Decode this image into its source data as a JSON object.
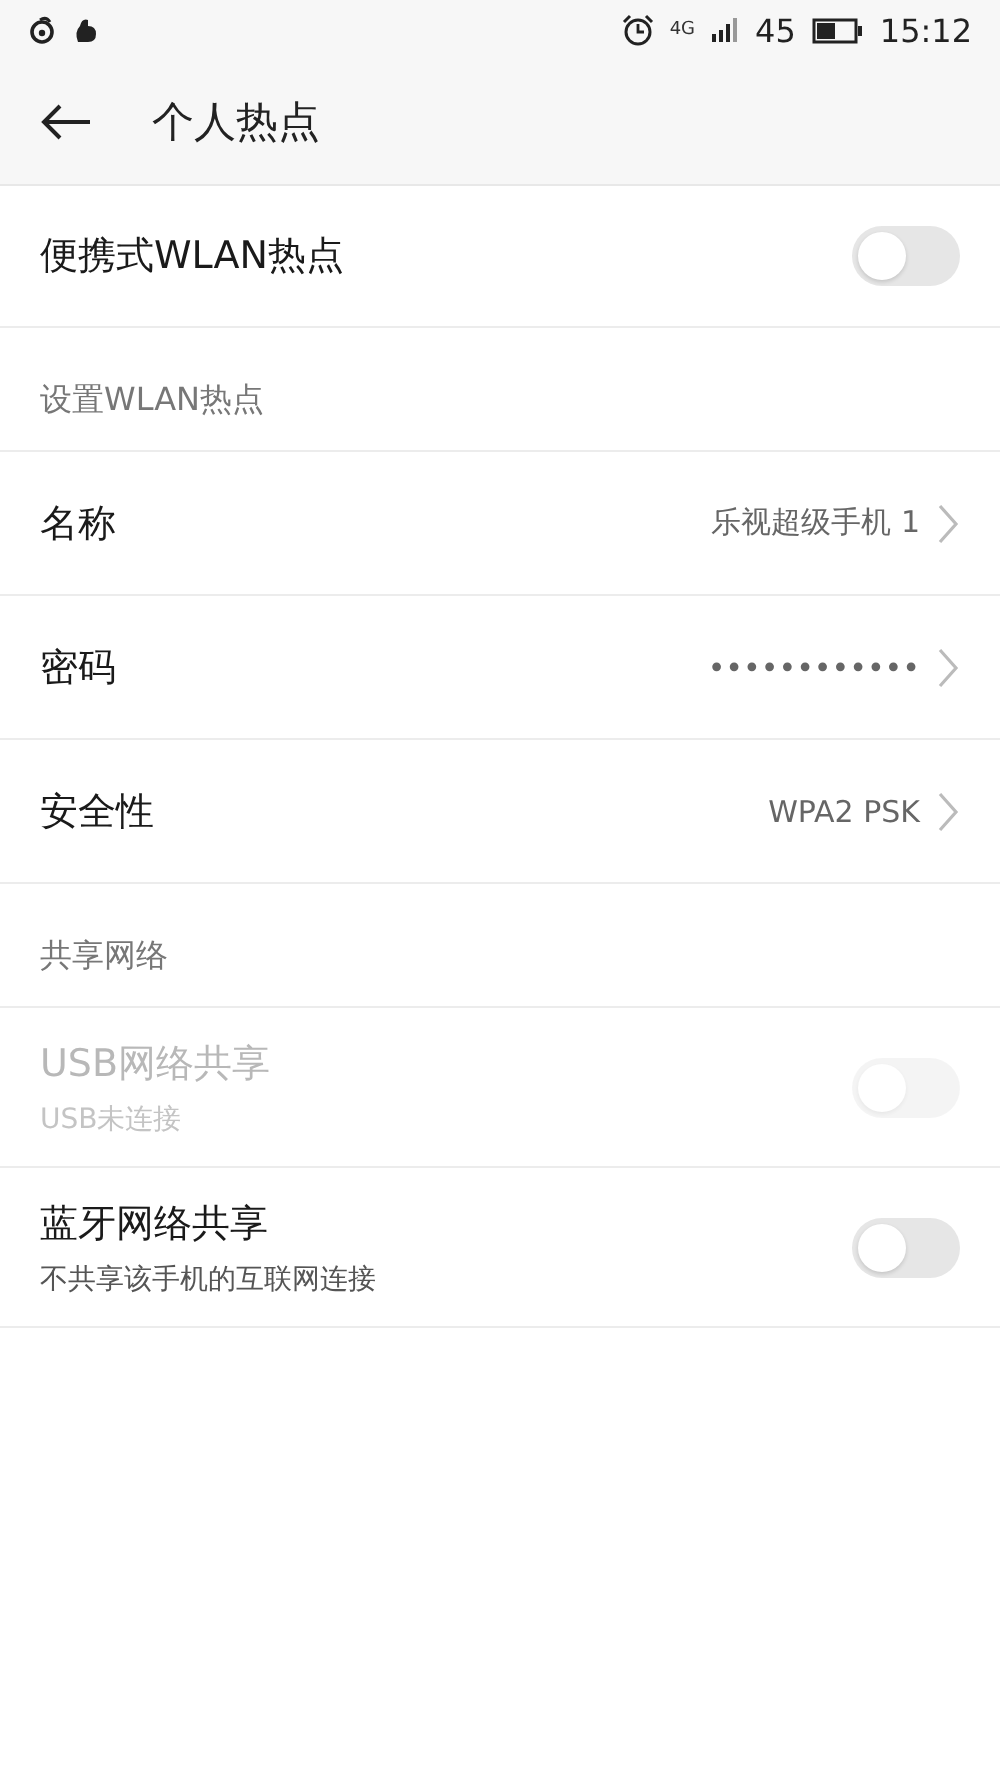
{
  "status_bar": {
    "network": "4G",
    "battery": "45",
    "time": "15:12"
  },
  "header": {
    "title": "个人热点"
  },
  "items": [
    {
      "kind": "toggle",
      "label": "便携式WLAN热点",
      "on": false,
      "disabled": false
    },
    {
      "kind": "section",
      "label": "设置WLAN热点"
    },
    {
      "kind": "link",
      "label": "名称",
      "value": "乐视超级手机 1"
    },
    {
      "kind": "link",
      "label": "密码",
      "value": "••••••••••••"
    },
    {
      "kind": "link",
      "label": "安全性",
      "value": "WPA2 PSK"
    },
    {
      "kind": "section",
      "label": "共享网络"
    },
    {
      "kind": "toggle",
      "label": "USB网络共享",
      "subtitle": "USB未连接",
      "on": false,
      "disabled": true
    },
    {
      "kind": "toggle",
      "label": "蓝牙网络共享",
      "subtitle": "不共享该手机的互联网连接",
      "on": false,
      "disabled": false
    }
  ]
}
